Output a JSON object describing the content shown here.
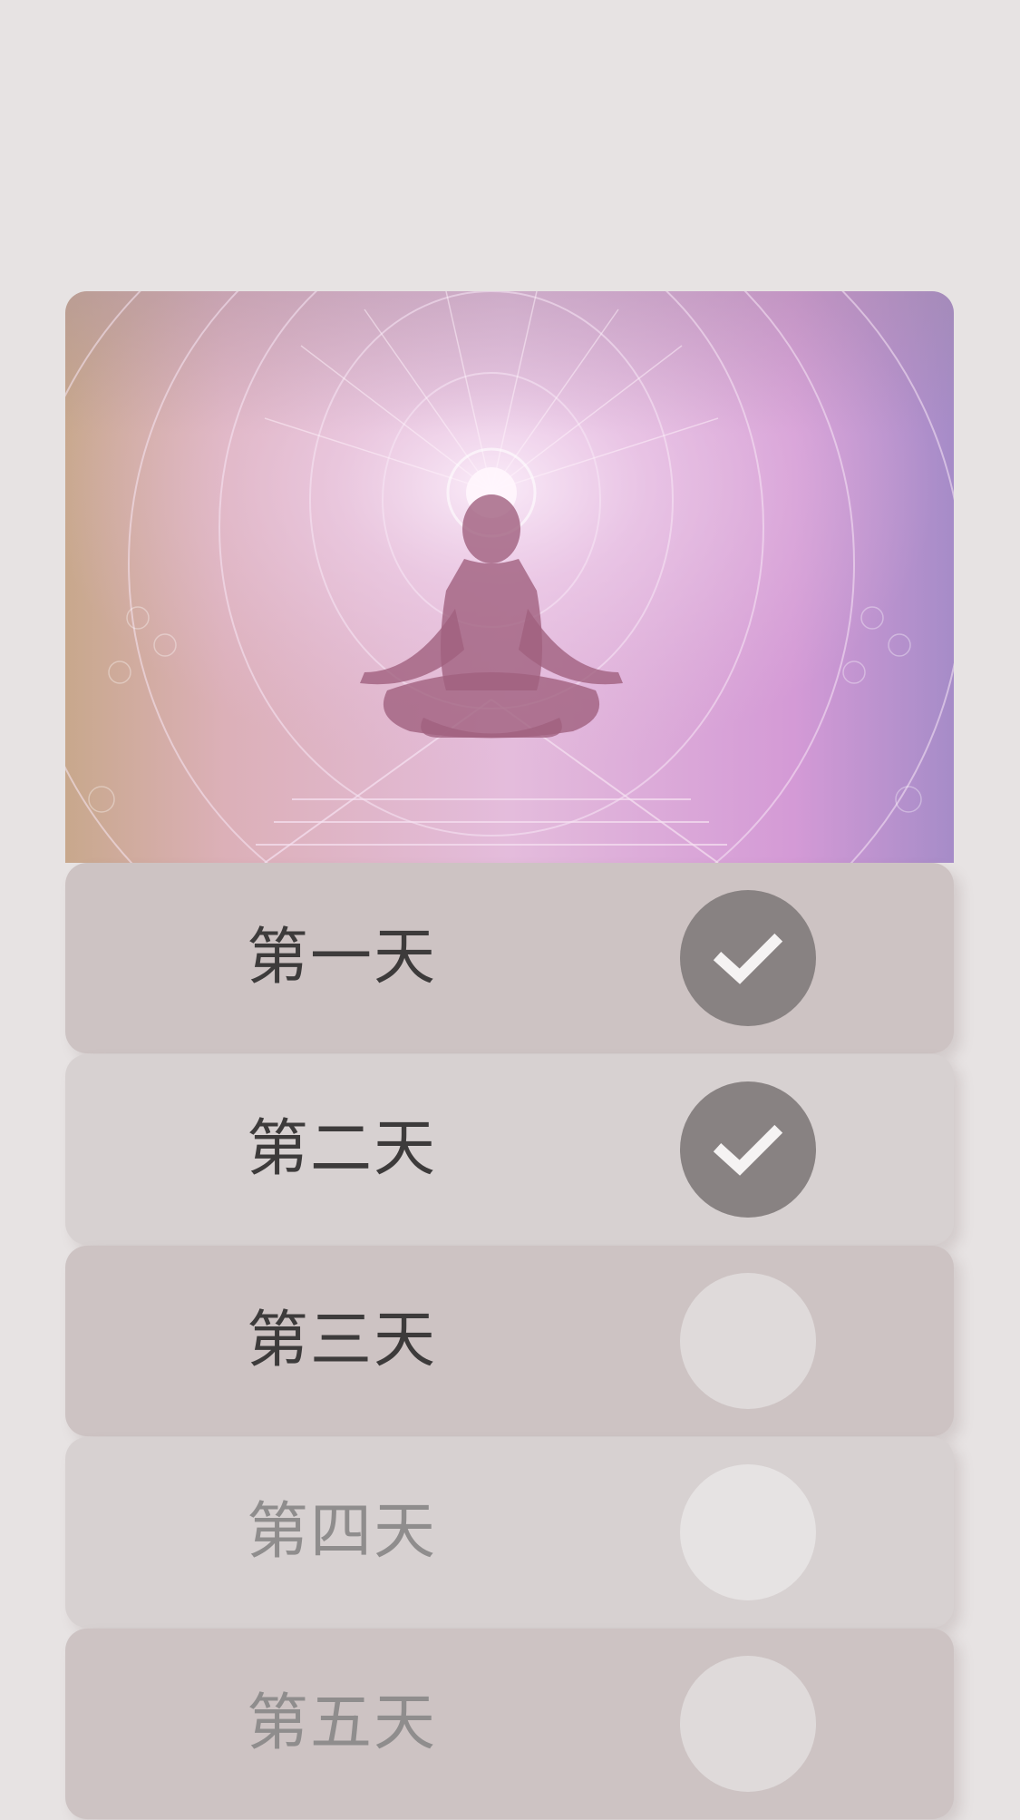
{
  "hero": {
    "icon": "meditation-figure-illustration"
  },
  "days": [
    {
      "label": "第一天",
      "completed": true
    },
    {
      "label": "第二天",
      "completed": true
    },
    {
      "label": "第三天",
      "completed": false
    },
    {
      "label": "第四天",
      "completed": false
    },
    {
      "label": "第五天",
      "completed": false
    }
  ],
  "colors": {
    "background": "#e7e3e3",
    "row_dark": "#cdc3c3",
    "row_light": "#d7d1d1",
    "check_done": "#888282",
    "checkmark": "#f5f3f3"
  }
}
